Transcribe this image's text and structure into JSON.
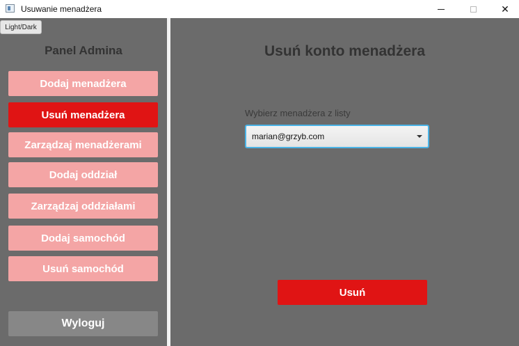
{
  "window": {
    "title": "Usuwanie menadżera",
    "minimize_icon": "minimize-icon",
    "maximize_icon": "maximize-icon",
    "close_symbol": "✕"
  },
  "sidebar": {
    "theme_toggle_label": "Light/Dark",
    "title": "Panel Admina",
    "items": [
      {
        "label": "Dodaj menadżera",
        "active": false
      },
      {
        "label": "Usuń menadżera",
        "active": true
      },
      {
        "label": "Zarządzaj menadżerami",
        "active": false
      },
      {
        "label": "Dodaj oddział",
        "active": false
      },
      {
        "label": "Zarządzaj oddziałami",
        "active": false
      },
      {
        "label": "Dodaj samochód",
        "active": false
      },
      {
        "label": "Usuń samochód",
        "active": false
      }
    ],
    "logout_label": "Wyloguj"
  },
  "main": {
    "title": "Usuń konto menadżera",
    "select_label": "Wybierz menadżera z listy",
    "select_value": "marian@grzyb.com",
    "delete_label": "Usuń"
  },
  "colors": {
    "background": "#6b6b6b",
    "accent_active": "#e01414",
    "nav_inactive": "#f4a5a5",
    "logout": "#878787",
    "focus_border": "#4ab3e6"
  }
}
